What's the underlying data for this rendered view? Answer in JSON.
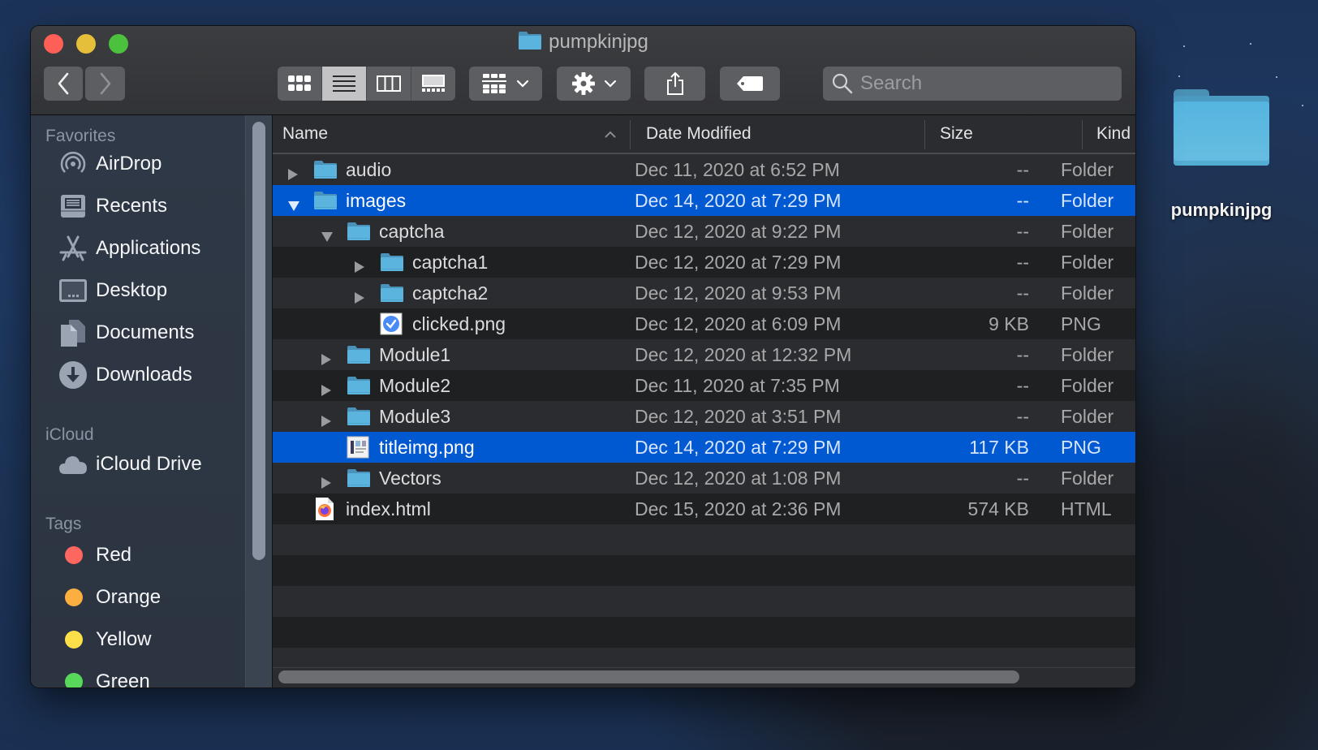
{
  "window": {
    "title": "pumpkinjpg",
    "search_placeholder": "Search",
    "search_value": ""
  },
  "toolbar": {
    "back_icon": "chevron-left-icon",
    "forward_icon": "chevron-right-icon",
    "view_modes": [
      "icon-view",
      "list-view",
      "column-view",
      "gallery-view"
    ],
    "active_view": "list-view",
    "group_icon": "group-by-icon",
    "action_icon": "gear-icon",
    "share_icon": "share-icon",
    "tag_icon": "tag-icon"
  },
  "sidebar": {
    "sections": {
      "favorites": "Favorites",
      "icloud": "iCloud",
      "tags": "Tags"
    },
    "favorites": [
      {
        "label": "AirDrop",
        "icon": "airdrop-icon"
      },
      {
        "label": "Recents",
        "icon": "recents-icon"
      },
      {
        "label": "Applications",
        "icon": "applications-icon"
      },
      {
        "label": "Desktop",
        "icon": "desktop-icon"
      },
      {
        "label": "Documents",
        "icon": "documents-icon"
      },
      {
        "label": "Downloads",
        "icon": "downloads-icon"
      }
    ],
    "icloud": [
      {
        "label": "iCloud Drive",
        "icon": "cloud-icon"
      }
    ],
    "tags": [
      {
        "label": "Red",
        "color": "#fe6660"
      },
      {
        "label": "Orange",
        "color": "#fdae40"
      },
      {
        "label": "Yellow",
        "color": "#fddf4a"
      },
      {
        "label": "Green",
        "color": "#58d85a"
      }
    ]
  },
  "columns": {
    "name": "Name",
    "date": "Date Modified",
    "size": "Size",
    "kind": "Kind",
    "sort_indicator": "ascending"
  },
  "files": [
    {
      "name": "audio",
      "date": "Dec 11, 2020 at 6:52 PM",
      "size": "--",
      "kind": "Folder",
      "type": "folder",
      "depth": 0,
      "disclosure": "collapsed",
      "selected": false
    },
    {
      "name": "images",
      "date": "Dec 14, 2020 at 7:29 PM",
      "size": "--",
      "kind": "Folder",
      "type": "folder",
      "depth": 0,
      "disclosure": "expanded",
      "selected": true
    },
    {
      "name": "captcha",
      "date": "Dec 12, 2020 at 9:22 PM",
      "size": "--",
      "kind": "Folder",
      "type": "folder",
      "depth": 1,
      "disclosure": "expanded",
      "selected": false
    },
    {
      "name": "captcha1",
      "date": "Dec 12, 2020 at 7:29 PM",
      "size": "--",
      "kind": "Folder",
      "type": "folder",
      "depth": 2,
      "disclosure": "collapsed",
      "selected": false
    },
    {
      "name": "captcha2",
      "date": "Dec 12, 2020 at 9:53 PM",
      "size": "--",
      "kind": "Folder",
      "type": "folder",
      "depth": 2,
      "disclosure": "collapsed",
      "selected": false
    },
    {
      "name": "clicked.png",
      "date": "Dec 12, 2020 at 6:09 PM",
      "size": "9 KB",
      "kind": "PNG",
      "type": "png-check",
      "depth": 2,
      "disclosure": "none",
      "selected": false
    },
    {
      "name": "Module1",
      "date": "Dec 12, 2020 at 12:32 PM",
      "size": "--",
      "kind": "Folder",
      "type": "folder",
      "depth": 1,
      "disclosure": "collapsed",
      "selected": false
    },
    {
      "name": "Module2",
      "date": "Dec 11, 2020 at 7:35 PM",
      "size": "--",
      "kind": "Folder",
      "type": "folder",
      "depth": 1,
      "disclosure": "collapsed",
      "selected": false
    },
    {
      "name": "Module3",
      "date": "Dec 12, 2020 at 3:51 PM",
      "size": "--",
      "kind": "Folder",
      "type": "folder",
      "depth": 1,
      "disclosure": "collapsed",
      "selected": false
    },
    {
      "name": "titleimg.png",
      "date": "Dec 14, 2020 at 7:29 PM",
      "size": "117 KB",
      "kind": "PNG",
      "type": "png-image",
      "depth": 1,
      "disclosure": "none",
      "selected": true
    },
    {
      "name": "Vectors",
      "date": "Dec 12, 2020 at 1:08 PM",
      "size": "--",
      "kind": "Folder",
      "type": "folder",
      "depth": 1,
      "disclosure": "collapsed",
      "selected": false
    },
    {
      "name": "index.html",
      "date": "Dec 15, 2020 at 2:36 PM",
      "size": "574 KB",
      "kind": "HTML",
      "type": "html-firefox",
      "depth": 0,
      "disclosure": "none",
      "selected": false
    }
  ],
  "desktop": {
    "icons": [
      {
        "label": "pumpkinjpg",
        "icon": "folder-icon"
      }
    ]
  },
  "colors": {
    "selection": "#0059d1",
    "folder": "#5ab4de"
  }
}
